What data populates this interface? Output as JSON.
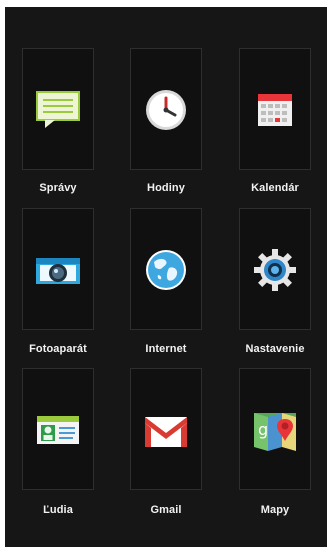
{
  "apps": [
    {
      "label": "Správy",
      "icon": "messages-icon"
    },
    {
      "label": "Hodiny",
      "icon": "clock-icon"
    },
    {
      "label": "Kalendár",
      "icon": "calendar-icon"
    },
    {
      "label": "Fotoaparát",
      "icon": "camera-icon"
    },
    {
      "label": "Internet",
      "icon": "globe-icon"
    },
    {
      "label": "Nastavenie",
      "icon": "gear-icon"
    },
    {
      "label": "Ľudia",
      "icon": "contact-card-icon"
    },
    {
      "label": "Gmail",
      "icon": "gmail-icon"
    },
    {
      "label": "Mapy",
      "icon": "maps-icon"
    }
  ],
  "colors": {
    "background": "#161616",
    "tile": "#101010",
    "tile_border": "#2e2e2e",
    "label": "#f2f2f2",
    "messages_green": "#9bcb3c",
    "calendar_red": "#e8353a",
    "camera_blue": "#2fa8e0",
    "globe_blue": "#3ea7df",
    "gear_blue": "#2f86c9",
    "gmail_red": "#d93b32"
  }
}
